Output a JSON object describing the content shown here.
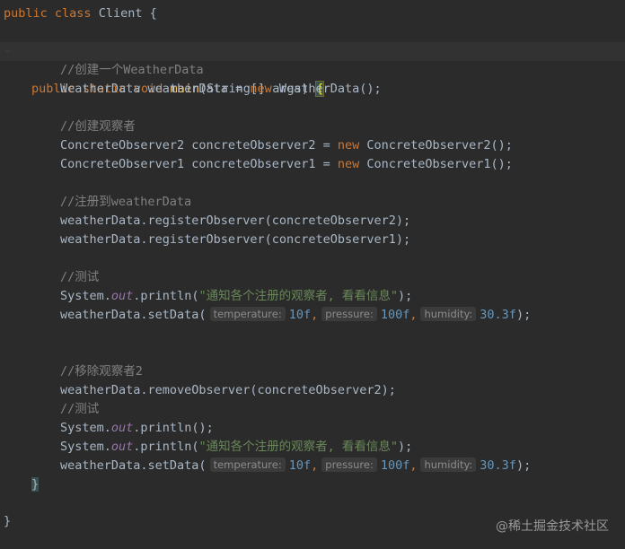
{
  "code": {
    "class_decl": {
      "kw1": "public",
      "kw2": "class",
      "name": "Client",
      "brace": "{"
    },
    "method_decl": {
      "kw1": "public",
      "kw2": "static",
      "kw3": "void",
      "name": "main",
      "params": "(String[] args) ",
      "brace": "{"
    },
    "comment1": "//创建一个WeatherData",
    "line_wd": {
      "pre": "WeatherData weatherData = ",
      "kw": "new",
      "post": " WeatherData();"
    },
    "comment2": "//创建观察者",
    "line_obs2": {
      "pre": "ConcreteObserver2 concreteObserver2 = ",
      "kw": "new",
      "post": " ConcreteObserver2();"
    },
    "line_obs1": {
      "pre": "ConcreteObserver1 concreteObserver1 = ",
      "kw": "new",
      "post": " ConcreteObserver1();"
    },
    "comment3": "//注册到weatherData",
    "line_reg2": "weatherData.registerObserver(concreteObserver2);",
    "line_reg1": "weatherData.registerObserver(concreteObserver1);",
    "comment4": "//测试",
    "println1": {
      "pre": "System.",
      "field": "out",
      "mid": ".println(",
      "str": "\"通知各个注册的观察者, 看看信息\"",
      "post": ");"
    },
    "setdata1": {
      "pre": "weatherData.setData(",
      "hint1": "temperature:",
      "val1": "10f",
      "sep1": ",",
      "hint2": "pressure:",
      "val2": "100f",
      "sep2": ",",
      "hint3": "humidity:",
      "val3": "30.3f",
      "post": ");"
    },
    "comment5": "//移除观察者2",
    "line_remove": "weatherData.removeObserver(concreteObserver2);",
    "comment6": "//测试",
    "println_empty": {
      "pre": "System.",
      "field": "out",
      "post": ".println();"
    },
    "println2": {
      "pre": "System.",
      "field": "out",
      "mid": ".println(",
      "str": "\"通知各个注册的观察者, 看看信息\"",
      "post": ");"
    },
    "setdata2": {
      "pre": "weatherData.setData(",
      "hint1": "temperature:",
      "val1": "10f",
      "sep1": ",",
      "hint2": "pressure:",
      "val2": "100f",
      "sep2": ",",
      "hint3": "humidity:",
      "val3": "30.3f",
      "post": ");"
    },
    "method_close": "}",
    "class_close": "}"
  },
  "watermark": "@稀土掘金技术社区",
  "colors": {
    "background": "#2b2b2b",
    "keyword": "#cc7832",
    "function": "#ffc66d",
    "comment": "#808080",
    "string": "#6a8759",
    "number": "#6897bb",
    "field": "#9876aa",
    "text": "#a9b7c6"
  }
}
